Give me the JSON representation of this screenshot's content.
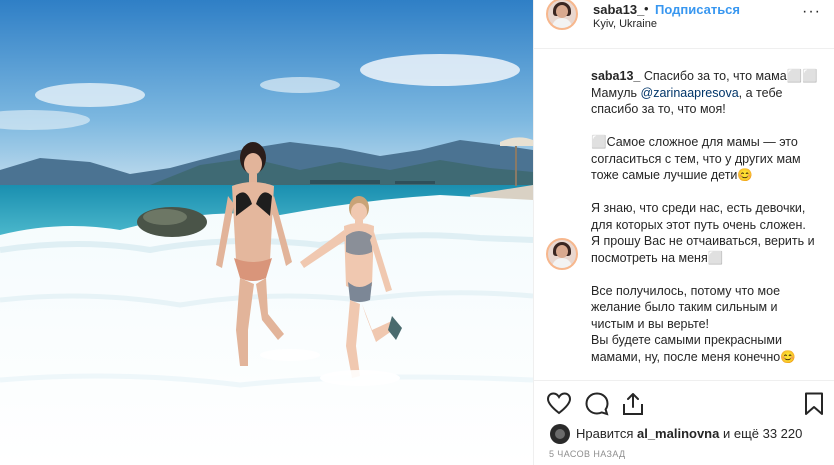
{
  "post": {
    "username": "saba13_",
    "dot": "•",
    "follow_label": "Подписаться",
    "location": "Kyiv, Ukraine",
    "more_label": "···"
  },
  "caption": {
    "username": "saba13_",
    "line1_rest": " Спасибо за то, что мама⬜⬜",
    "line2_prefix": "Мамуль ",
    "mention": "@zarinaapresova",
    "line2_suffix": ", а тебе спасибо за то, что моя!",
    "para2": "⬜Самое сложное для мамы — это согласиться с тем, что у других мам тоже самые лучшие дети😊",
    "para3a": "Я знаю, что среди нас, есть девочки, для которых этот путь очень сложен.",
    "para3b": "Я прошу Вас не отчаиваться, верить и посмотреть на меня⬜",
    "para4a": "Все получилось, потому что мое желание было таким сильным и чистым и вы верьте!",
    "para4b": "Вы будете самыми прекрасными мамами, ну, после меня конечно😊"
  },
  "likes": {
    "prefix": "Нравится ",
    "user": "al_malinovna",
    "suffix": " и ещё 33 220"
  },
  "timestamp": "5 ЧАСОВ НАЗАД",
  "icons": {
    "like": "heart-icon",
    "comment": "comment-icon",
    "share": "share-icon",
    "save": "bookmark-icon",
    "more": "more-icon"
  },
  "colors": {
    "follow": "#3897f0",
    "mention": "#003569",
    "muted": "#8e8e8e",
    "border": "#efefef"
  }
}
